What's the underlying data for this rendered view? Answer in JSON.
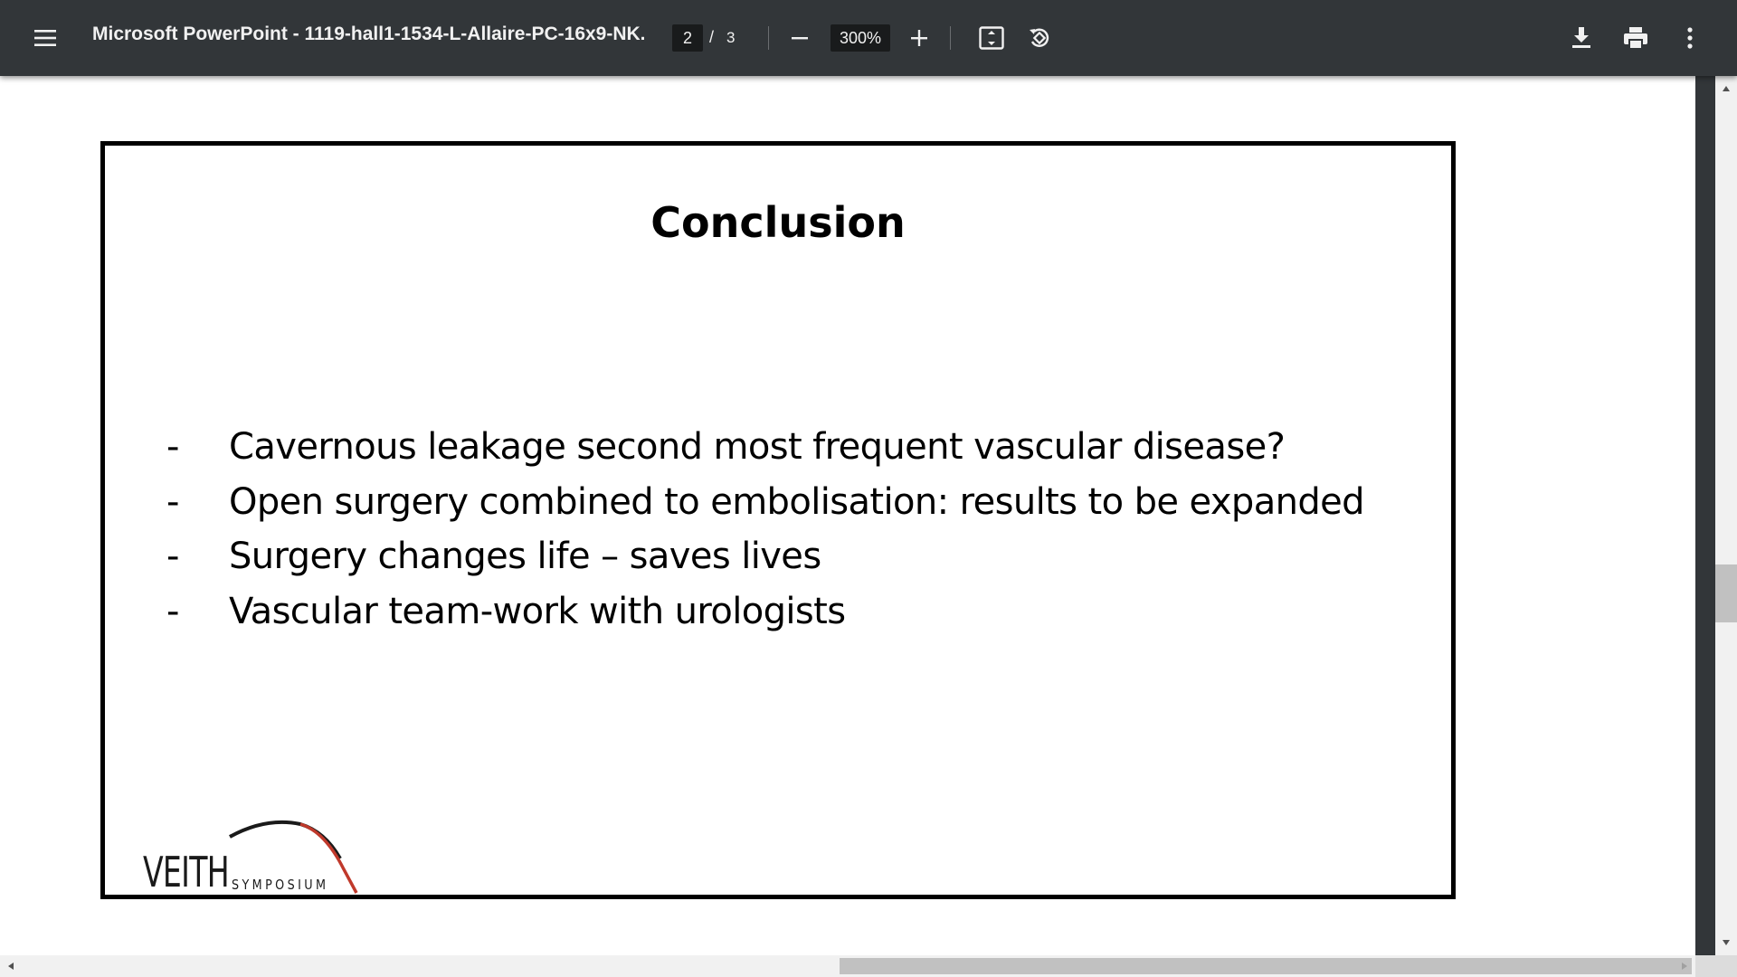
{
  "toolbar": {
    "menu_icon": "hamburger-menu-icon",
    "title": "Microsoft PowerPoint - 1119-hall1-1534-L-Allaire-PC-16x9-NK.p...",
    "page_current": "2",
    "page_separator": "/",
    "page_total": "3",
    "zoom_out_icon": "minus-icon",
    "zoom_value": "300%",
    "zoom_in_icon": "plus-icon",
    "fit_page_icon": "fit-to-page-icon",
    "rotate_icon": "rotate-counterclockwise-icon",
    "download_icon": "download-icon",
    "print_icon": "print-icon",
    "more_icon": "more-vertical-icon",
    "background_color": "#323639"
  },
  "slide": {
    "title": "Conclusion",
    "bullets": [
      {
        "marker": "-",
        "text": "Cavernous leakage second most frequent vascular disease?"
      },
      {
        "marker": "-",
        "text": "Open surgery combined to embolisation: results to be expanded"
      },
      {
        "marker": "-",
        "text": "Surgery changes life – saves lives"
      },
      {
        "marker": "-",
        "text": "Vascular team-work with urologists"
      }
    ],
    "logo": {
      "main": "VEITH",
      "sub": "SYMPOSIUM",
      "arc_colors": [
        "#1a1a1a",
        "#c0392b"
      ]
    }
  },
  "scrollbars": {
    "vertical_thumb_color": "#c1c1c1",
    "horizontal_thumb_color": "#c1c1c1"
  }
}
